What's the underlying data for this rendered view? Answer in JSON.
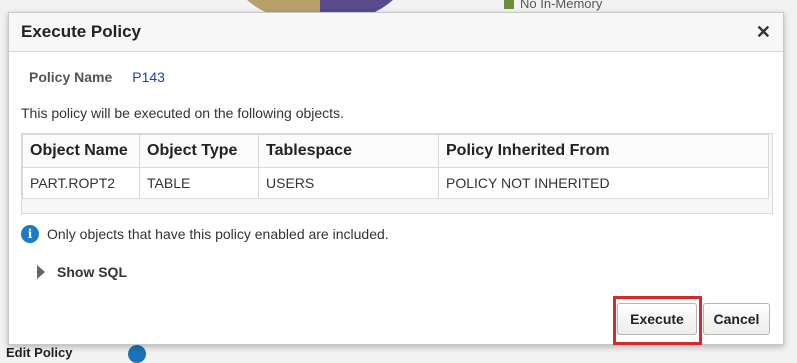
{
  "background": {
    "legend_label": "No In-Memory",
    "bottom_label": "Edit Policy"
  },
  "dialog": {
    "title": "Execute Policy",
    "close_symbol": "✕",
    "policy_name_label": "Policy Name",
    "policy_name_value": "P143",
    "description": "This policy will be executed on the following objects.",
    "table": {
      "headers": [
        "Object Name",
        "Object Type",
        "Tablespace",
        "Policy Inherited From"
      ],
      "rows": [
        [
          "PART.ROPT2",
          "TABLE",
          "USERS",
          "POLICY NOT INHERITED"
        ]
      ]
    },
    "note": "Only objects that have this policy enabled are included.",
    "show_sql_label": "Show SQL",
    "execute_label": "Execute",
    "cancel_label": "Cancel"
  },
  "colors": {
    "link_blue": "#1f3fa6",
    "info_blue": "#1f7ac3",
    "highlight_red": "#d22b2b"
  },
  "icons": {
    "close": "close-icon",
    "info": "info-icon",
    "expand": "triangle-right-icon"
  }
}
